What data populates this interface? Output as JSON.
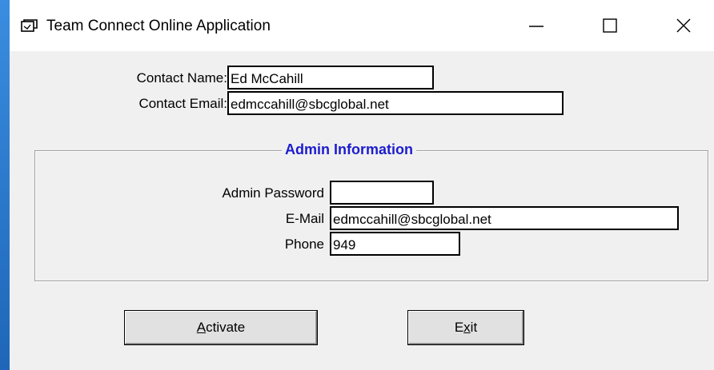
{
  "window": {
    "title": "Team Connect Online Application",
    "icon": "app-window-icon",
    "controls": [
      "minimize-icon",
      "maximize-icon",
      "close-icon"
    ]
  },
  "contact": {
    "name_label": "Contact Name:",
    "name_value": "Ed McCahill",
    "email_label": "Contact Email:",
    "email_value": "edmccahill@sbcglobal.net"
  },
  "admin": {
    "legend": "Admin Information",
    "legend_color": "#1c1cd0",
    "password_label": "Admin Password",
    "password_value": "",
    "email_label": "E-Mail",
    "email_value": "edmccahill@sbcglobal.net",
    "phone_label": "Phone",
    "phone_value": "949"
  },
  "buttons": {
    "activate_hotkey": "A",
    "activate_rest": "ctivate",
    "exit_before": "E",
    "exit_hotkey": "x",
    "exit_after": "it"
  }
}
